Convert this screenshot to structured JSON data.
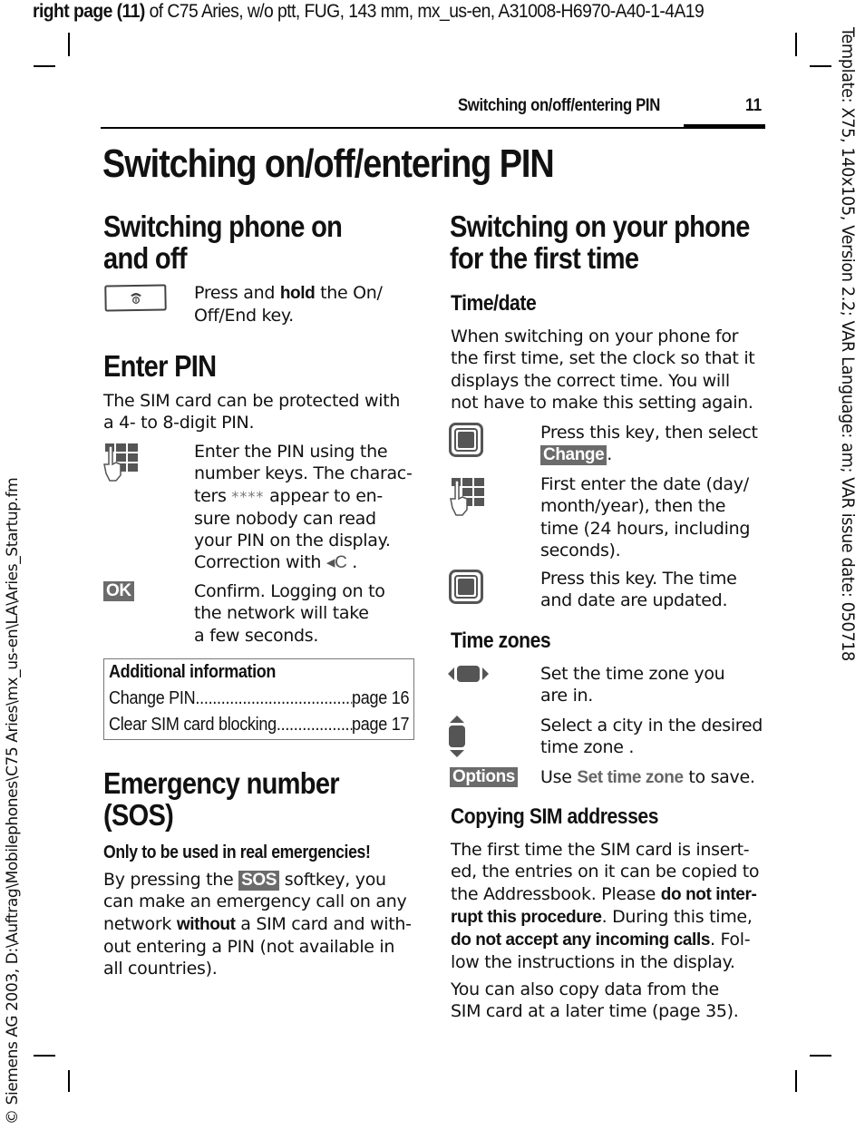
{
  "slug": {
    "bold": "right page (11)",
    "rest": " of C75 Aries, w/o ptt, FUG, 143 mm, mx_us-en, A31008-H6970-A40-1-4A19"
  },
  "side_right": "Template: X75, 140x105, Version 2.2; VAR Language: am; VAR issue date: 050718",
  "side_left": "© Siemens AG 2003, D:\\Auftrag\\Mobilephones\\C75 Aries\\mx_us-en\\LA\\Aries_Startup.fm",
  "header": {
    "running_title": "Switching on/off/entering PIN",
    "page_number": "11"
  },
  "title": "Switching on/off/entering PIN",
  "left": {
    "switching": {
      "heading_line1": "Switching phone on",
      "heading_line2": "and off",
      "step": {
        "icon": "on-off-end-key-icon",
        "t1": "Press and ",
        "t1b": "hold",
        "t1c": " the On/",
        "t2": "Off/End key."
      }
    },
    "enter_pin": {
      "heading": "Enter PIN",
      "intro_line1": "The SIM card can be protected with",
      "intro_line2": "a 4- to 8-digit PIN.",
      "step1": {
        "icon": "keypad-hand-icon",
        "l1": "Enter the PIN using the",
        "l2": "number keys. The charac-",
        "l3a": "ters ",
        "stars": "****",
        "l3b": " appear to en-",
        "l4": "sure nobody can read",
        "l5": "your PIN on the display.",
        "l6a": "Correction with ",
        "clear_key": "◂C",
        "l6b": " ."
      },
      "step2": {
        "softkey": "OK",
        "l1": "Confirm. Logging on to",
        "l2": "the network will take",
        "l3": "a few seconds."
      }
    },
    "additional_info": {
      "title": "Additional information",
      "rows": [
        {
          "label": "Change PIN",
          "page": "page 16"
        },
        {
          "label": "Clear SIM card blocking ",
          "page": "page 17"
        }
      ]
    },
    "emergency": {
      "heading_line1": "Emergency number",
      "heading_line2": "(SOS)",
      "warning": "Only to be used in real emergencies!",
      "l1a": "By pressing the ",
      "softkey": "SOS",
      "l1b": " softkey, you",
      "l2": "can make an emergency call on any",
      "l3a": "network ",
      "l3b": "without",
      "l3c": " a SIM card and with-",
      "l4": "out entering a PIN (not available in",
      "l5": "all countries)."
    }
  },
  "right": {
    "heading_line1": "Switching on your phone",
    "heading_line2": "for the first time",
    "timedate": {
      "heading": "Time/date",
      "intro": [
        "When switching on your phone for",
        "the first time, set the clock so that it",
        "displays the correct time. You will",
        "not have to make this setting again."
      ],
      "step1": {
        "icon": "center-key-icon",
        "l1": "Press this key, then select",
        "softkey": "Change",
        "after": "."
      },
      "step2": {
        "icon": "keypad-hand-icon",
        "lines": [
          "First enter the date (day/",
          "month/year), then the",
          "time (24 hours, including",
          "seconds)."
        ]
      },
      "step3": {
        "icon": "center-key-icon",
        "lines": [
          "Press this key. The time",
          "and date are updated."
        ]
      }
    },
    "timezones": {
      "heading": "Time zones",
      "step1": {
        "icon": "left-right-navigation-icon",
        "lines": [
          "Set the time zone you",
          "are in."
        ]
      },
      "step2": {
        "icon": "up-down-navigation-icon",
        "lines": [
          "Select a city in the desired",
          "time zone ."
        ]
      },
      "step3": {
        "softkey": "Options",
        "a": "Use ",
        "menu": "Set time zone",
        "b": " to save."
      }
    },
    "copying": {
      "heading": "Copying SIM addresses",
      "l1": "The first time the SIM card is insert-",
      "l2": "ed, the entries on it can be copied to",
      "l3a": "the Addressbook. Please ",
      "l3b": "do not inter-",
      "l4a": "rupt this procedure",
      "l4b": ". During this time,",
      "l5a": "do not accept any incoming calls",
      "l5b": ". Fol-",
      "l6": "low the instructions in the display.",
      "p2": [
        "You can also copy data from the",
        "SIM card at a later time (page 35)."
      ]
    }
  }
}
